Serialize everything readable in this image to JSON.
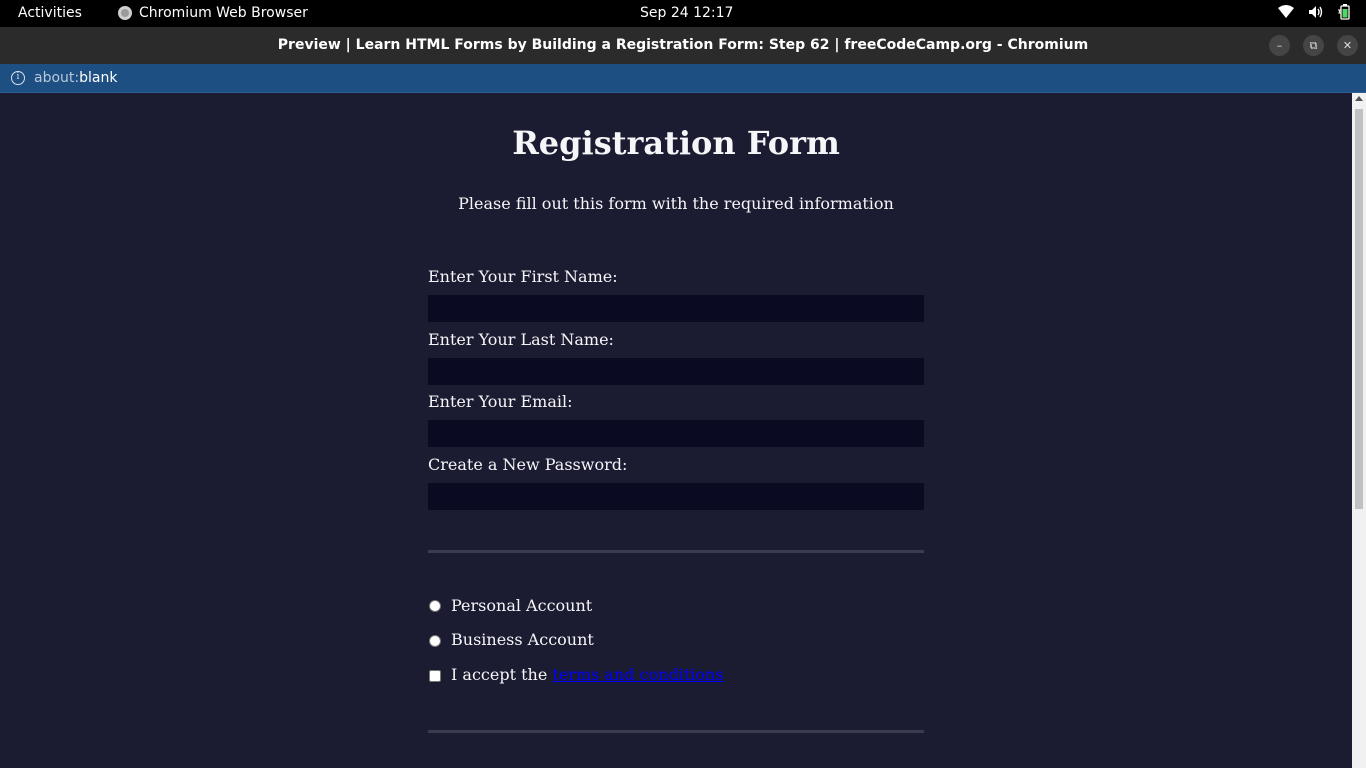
{
  "topbar": {
    "activities": "Activities",
    "app_name": "Chromium Web Browser",
    "clock": "Sep 24  12:17",
    "icons": [
      "wifi-icon",
      "volume-icon",
      "battery-icon"
    ]
  },
  "window": {
    "title": "Preview | Learn HTML Forms by Building a Registration Form: Step 62 | freeCodeCamp.org - Chromium"
  },
  "address": {
    "scheme": "about:",
    "path": "blank"
  },
  "page": {
    "heading": "Registration Form",
    "subtitle": "Please fill out this form with the required information",
    "fields": [
      {
        "label": "Enter Your First Name:"
      },
      {
        "label": "Enter Your Last Name:"
      },
      {
        "label": "Enter Your Email:"
      },
      {
        "label": "Create a New Password:"
      }
    ],
    "account_options": [
      "Personal Account",
      "Business Account"
    ],
    "terms_prefix": "I accept the ",
    "terms_link": "terms and conditions"
  },
  "colors": {
    "page_bg": "#1b1b32",
    "input_bg": "#0a0a23",
    "divider": "#3b3b4f",
    "address_bar": "#1d4f82"
  }
}
